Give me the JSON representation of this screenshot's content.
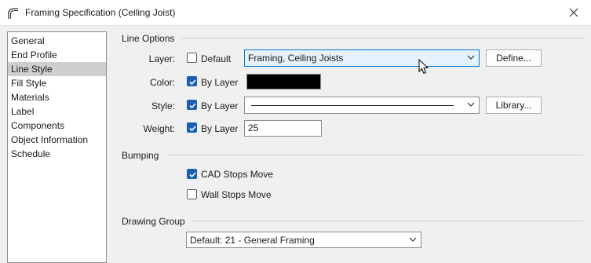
{
  "window": {
    "title": "Framing Specification (Ceiling Joist)"
  },
  "nav": {
    "items": [
      {
        "label": "General",
        "selected": false
      },
      {
        "label": "End Profile",
        "selected": false
      },
      {
        "label": "Line Style",
        "selected": true
      },
      {
        "label": "Fill Style",
        "selected": false
      },
      {
        "label": "Materials",
        "selected": false
      },
      {
        "label": "Label",
        "selected": false
      },
      {
        "label": "Components",
        "selected": false
      },
      {
        "label": "Object Information",
        "selected": false
      },
      {
        "label": "Schedule",
        "selected": false
      }
    ]
  },
  "line_options": {
    "group_label": "Line Options",
    "layer": {
      "label": "Layer:",
      "default_label": "Default",
      "default_checked": false,
      "value": "Framing, Ceiling Joists",
      "define_label": "Define..."
    },
    "color": {
      "label": "Color:",
      "by_layer_label": "By Layer",
      "by_layer_checked": true,
      "swatch_color": "#000000"
    },
    "style": {
      "label": "Style:",
      "by_layer_label": "By Layer",
      "by_layer_checked": true,
      "library_label": "Library..."
    },
    "weight": {
      "label": "Weight:",
      "by_layer_label": "By Layer",
      "by_layer_checked": true,
      "value": "25"
    }
  },
  "bumping": {
    "group_label": "Bumping",
    "cad_stops_label": "CAD Stops Move",
    "cad_stops_checked": true,
    "wall_stops_label": "Wall Stops Move",
    "wall_stops_checked": false
  },
  "drawing_group": {
    "group_label": "Drawing Group",
    "value": "Default: 21 - General Framing"
  },
  "colors": {
    "accent": "#1a5fb4",
    "focus_border": "#0078d7"
  }
}
